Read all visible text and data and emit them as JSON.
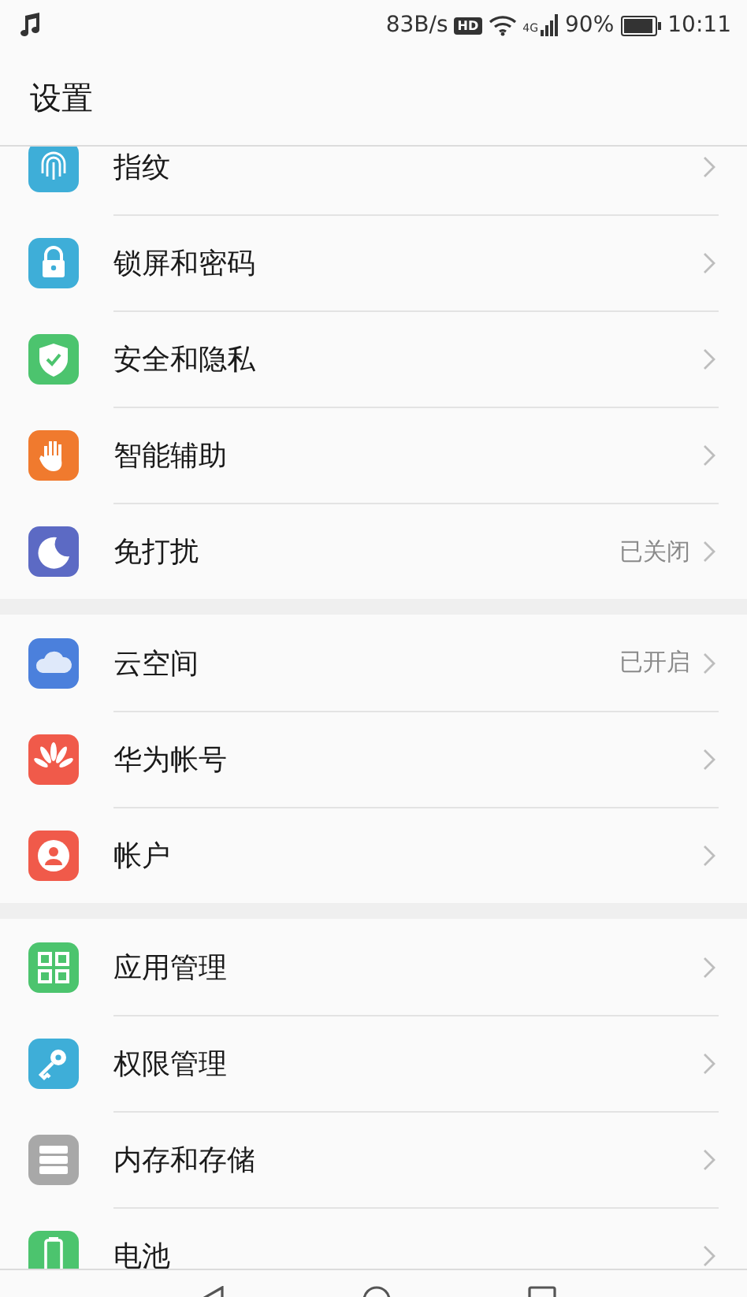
{
  "status_bar": {
    "speed": "83B/s",
    "hd_badge": "HD",
    "network": "4G",
    "battery": "90%",
    "time": "10:11"
  },
  "header": {
    "title": "设置"
  },
  "sections": [
    {
      "items": [
        {
          "label": "指纹"
        },
        {
          "label": "锁屏和密码"
        },
        {
          "label": "安全和隐私"
        },
        {
          "label": "智能辅助"
        },
        {
          "label": "免打扰",
          "value": "已关闭"
        }
      ]
    },
    {
      "items": [
        {
          "label": "云空间",
          "value": "已开启"
        },
        {
          "label": "华为帐号"
        },
        {
          "label": "帐户"
        }
      ]
    },
    {
      "items": [
        {
          "label": "应用管理"
        },
        {
          "label": "权限管理"
        },
        {
          "label": "内存和存储"
        },
        {
          "label": "电池"
        }
      ]
    }
  ]
}
